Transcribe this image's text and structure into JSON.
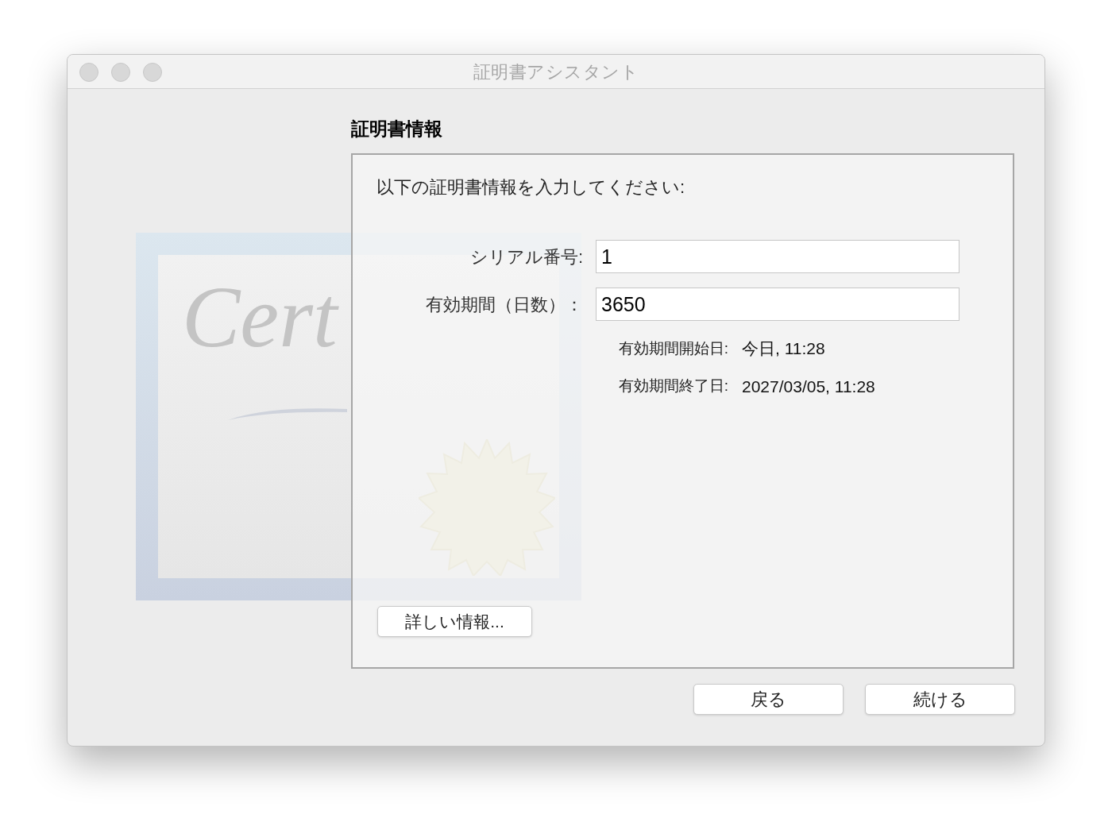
{
  "window": {
    "title": "証明書アシスタント"
  },
  "heading": "証明書情報",
  "illustration": {
    "text": "Cert"
  },
  "panel": {
    "prompt": "以下の証明書情報を入力してください:",
    "fields": [
      {
        "label": "シリアル番号:",
        "value": "1"
      },
      {
        "label": "有効期間（日数）：",
        "value": "3650"
      }
    ],
    "info": [
      {
        "label": "有効期間開始日:",
        "value": "今日, 11:28"
      },
      {
        "label": "有効期間終了日:",
        "value": "2027/03/05, 11:28"
      }
    ],
    "more_button": "詳しい情報..."
  },
  "buttons": [
    "戻る",
    "続ける"
  ]
}
